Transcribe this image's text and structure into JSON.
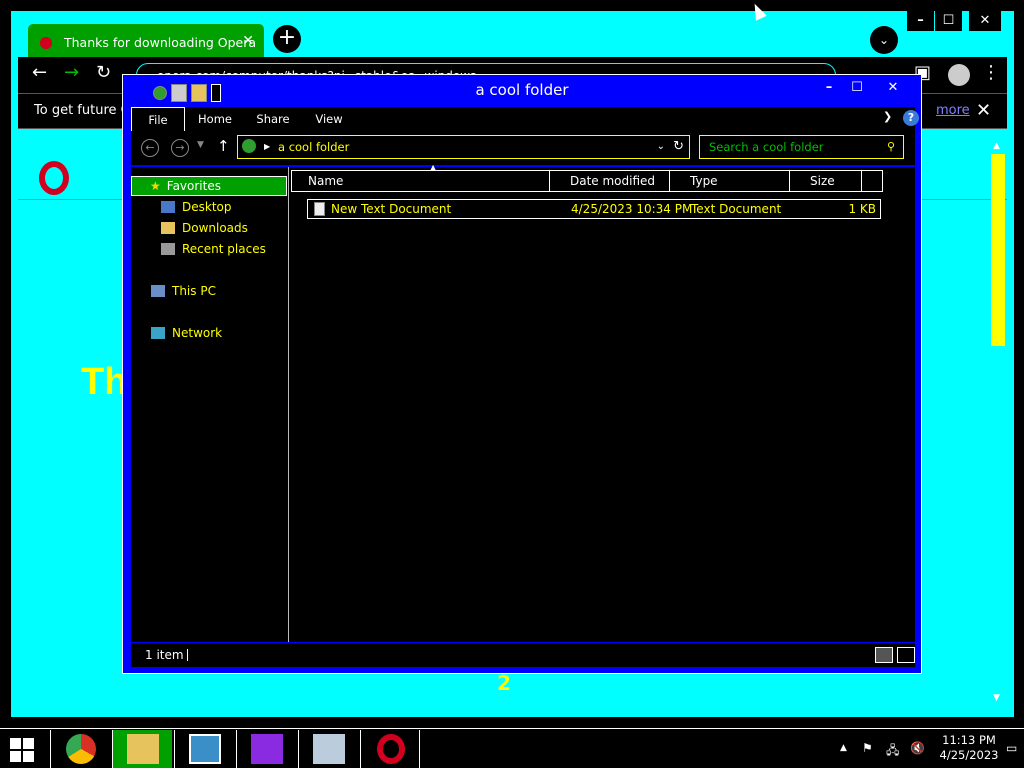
{
  "browser": {
    "tab_title": "Thanks for downloading Opera",
    "tab_close": "✕",
    "new_tab": "+",
    "tab_menu": "⌄",
    "url": "opera.com/computer/thanks?ni=stable&os=windows",
    "infobar_text": "To get future G",
    "infobar_more": "more",
    "infobar_close": "✕",
    "big_text": "Th",
    "page_number": "2"
  },
  "explorer": {
    "title": "a cool folder",
    "ribbon_tabs": [
      "File",
      "Home",
      "Share",
      "View"
    ],
    "address": "a cool folder",
    "search_placeholder": "Search a cool folder",
    "nav": {
      "favorites": "Favorites",
      "desktop": "Desktop",
      "downloads": "Downloads",
      "recent": "Recent places",
      "this_pc": "This PC",
      "network": "Network"
    },
    "columns": [
      "Name",
      "Date modified",
      "Type",
      "Size"
    ],
    "files": [
      {
        "name": "New Text Document",
        "date": "4/25/2023 10:34 PM",
        "type": "Text Document",
        "size": "1 KB"
      }
    ],
    "status": "1 item"
  },
  "taskbar": {
    "time": "11:13 PM",
    "date": "4/25/2023"
  },
  "colors": {
    "accent_cyan": "#00ffff",
    "accent_green": "#00a000",
    "explorer_frame": "#0000ff",
    "text_yellow": "#ffff00"
  }
}
